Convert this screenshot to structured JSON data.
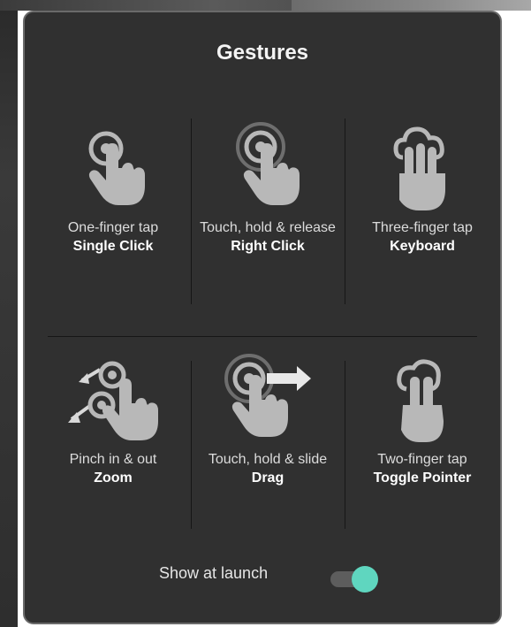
{
  "dialog": {
    "title": "Gestures",
    "gestures": [
      {
        "icon": "one-finger-tap-icon",
        "caption": "One-finger tap",
        "action": "Single Click"
      },
      {
        "icon": "touch-hold-release-icon",
        "caption": "Touch, hold & release",
        "action": "Right Click"
      },
      {
        "icon": "three-finger-tap-icon",
        "caption": "Three-finger tap",
        "action": "Keyboard"
      },
      {
        "icon": "pinch-zoom-icon",
        "caption": "Pinch in & out",
        "action": "Zoom"
      },
      {
        "icon": "touch-hold-slide-icon",
        "caption": "Touch, hold & slide",
        "action": "Drag"
      },
      {
        "icon": "two-finger-tap-icon",
        "caption": "Two-finger tap",
        "action": "Toggle Pointer"
      }
    ],
    "show_at_launch": {
      "label": "Show at launch",
      "enabled": true
    }
  },
  "colors": {
    "panel": "#303030",
    "accent": "#5fd6bf",
    "icon": "#b8b8b8"
  }
}
